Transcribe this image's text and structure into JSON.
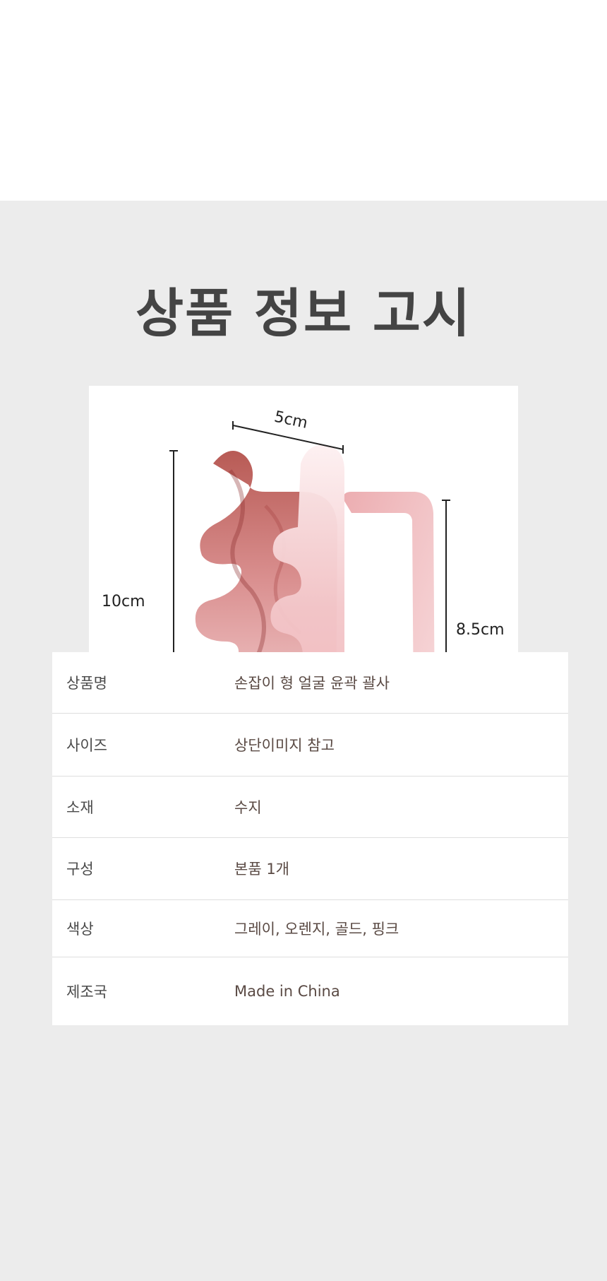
{
  "section": {
    "title": "상품 정보 고시"
  },
  "product_image": {
    "dimensions": {
      "width": "5cm",
      "height": "10cm",
      "handle_height": "8.5cm"
    },
    "colors": {
      "resin_dark": "#b0504a",
      "resin_mid": "#e4a2a4",
      "resin_light": "#fbe4e6"
    }
  },
  "spec_table": {
    "rows": [
      {
        "label": "상품명",
        "value": "손잡이 형 얼굴 윤곽 괄사"
      },
      {
        "label": "사이즈",
        "value": "상단이미지 참고"
      },
      {
        "label": "소재",
        "value": "수지"
      },
      {
        "label": "구성",
        "value": "본품 1개"
      },
      {
        "label": "색상",
        "value": "그레이, 오렌지, 골드, 핑크"
      },
      {
        "label": "제조국",
        "value": " Made in China"
      }
    ]
  }
}
